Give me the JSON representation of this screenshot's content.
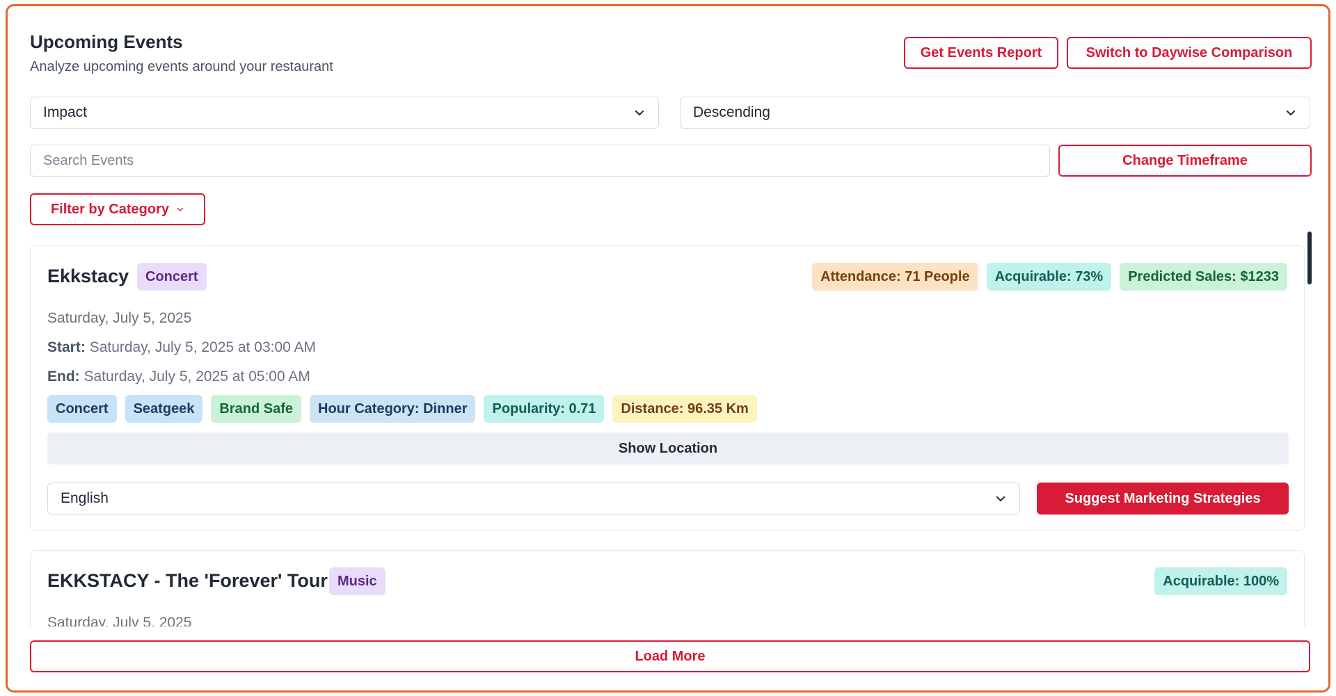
{
  "header": {
    "title": "Upcoming Events",
    "subtitle": "Analyze upcoming events around your restaurant",
    "report_button": "Get Events Report",
    "daywise_button": "Switch to Daywise Comparison"
  },
  "filters": {
    "sort_by": "Impact",
    "order": "Descending",
    "search_placeholder": "Search Events",
    "timeframe_button": "Change Timeframe",
    "category_button": "Filter by Category"
  },
  "events": [
    {
      "title": "Ekkstacy",
      "category": "Concert",
      "metrics": {
        "attendance": "Attendance: 71 People",
        "acquirable": "Acquirable: 73%",
        "predicted_sales": "Predicted Sales: $1233"
      },
      "date": "Saturday, July 5, 2025",
      "start_label": "Start:",
      "start": "Saturday, July 5, 2025 at 03:00 AM",
      "end_label": "End:",
      "end": "Saturday, July 5, 2025 at 05:00 AM",
      "tags": {
        "t1": "Concert",
        "t2": "Seatgeek",
        "t3": "Brand Safe",
        "t4": "Hour Category: Dinner",
        "t5": "Popularity: 0.71",
        "t6": "Distance: 96.35 Km"
      },
      "show_location": "Show Location",
      "language": "English",
      "suggest_button": "Suggest Marketing Strategies"
    },
    {
      "title": "EKKSTACY - The 'Forever' Tour",
      "category": "Music",
      "metrics": {
        "acquirable": "Acquirable: 100%"
      },
      "date": "Saturday, July 5, 2025"
    }
  ],
  "load_more": "Load More",
  "colors": {
    "accent": "#d81b36",
    "frame": "#e06a2c"
  }
}
